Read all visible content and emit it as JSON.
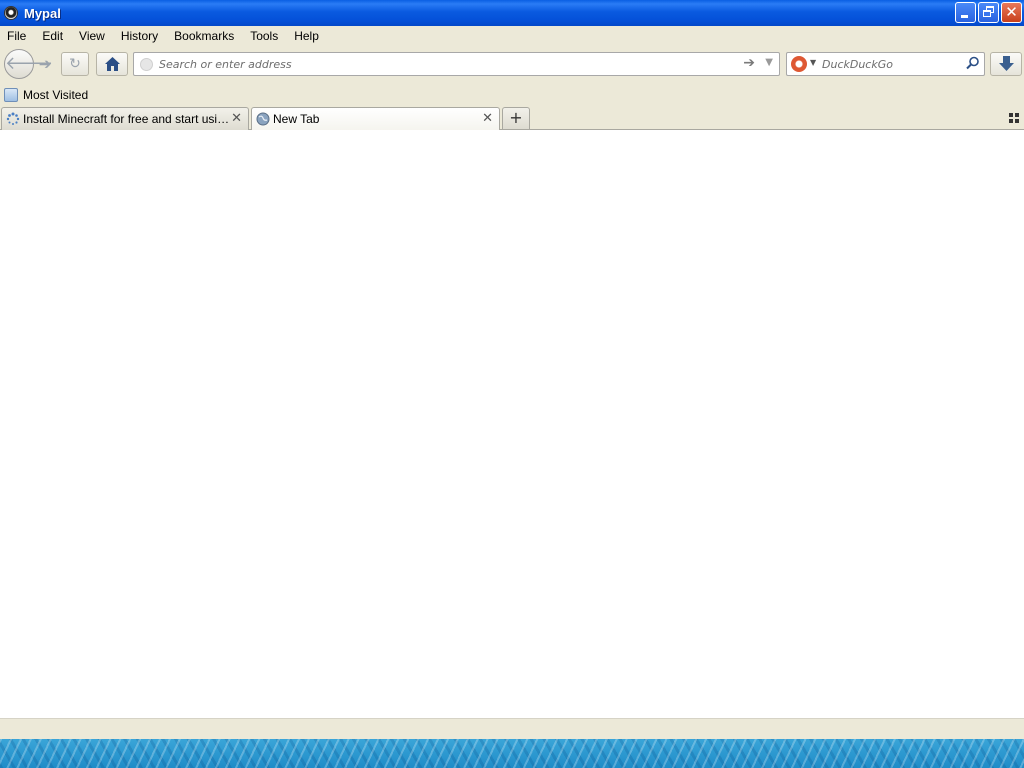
{
  "window": {
    "title": "Mypal",
    "icon": "mypal-app-icon",
    "controls": [
      "minimize-icon",
      "restore-icon",
      "close-icon"
    ]
  },
  "menubar": {
    "items": [
      {
        "label": "File"
      },
      {
        "label": "Edit"
      },
      {
        "label": "View"
      },
      {
        "label": "History"
      },
      {
        "label": "Bookmarks"
      },
      {
        "label": "Tools"
      },
      {
        "label": "Help"
      }
    ]
  },
  "navbar": {
    "back_icon": "arrow-left-icon",
    "forward_icon": "arrow-right-icon",
    "reload_icon": "reload-icon",
    "home_icon": "home-icon",
    "url_placeholder": "Search or enter address",
    "url_value": "",
    "search_engine": "DuckDuckGo",
    "search_engine_icon": "duckduckgo-icon",
    "download_icon": "download-arrow-icon"
  },
  "bookmarks": {
    "items": [
      {
        "label": "Most Visited",
        "icon": "most-visited-folder-icon"
      }
    ]
  },
  "tabs": [
    {
      "label": "Install Minecraft for free and start using i...",
      "selected": false,
      "icon": "loading-spinner-icon"
    },
    {
      "label": "New Tab",
      "selected": true,
      "icon": "globe-icon"
    }
  ],
  "colors": {
    "titlebar": "#0a5ae0",
    "chrome": "#ece9d8",
    "content": "#ffffff",
    "close_button": "#c8401c"
  }
}
